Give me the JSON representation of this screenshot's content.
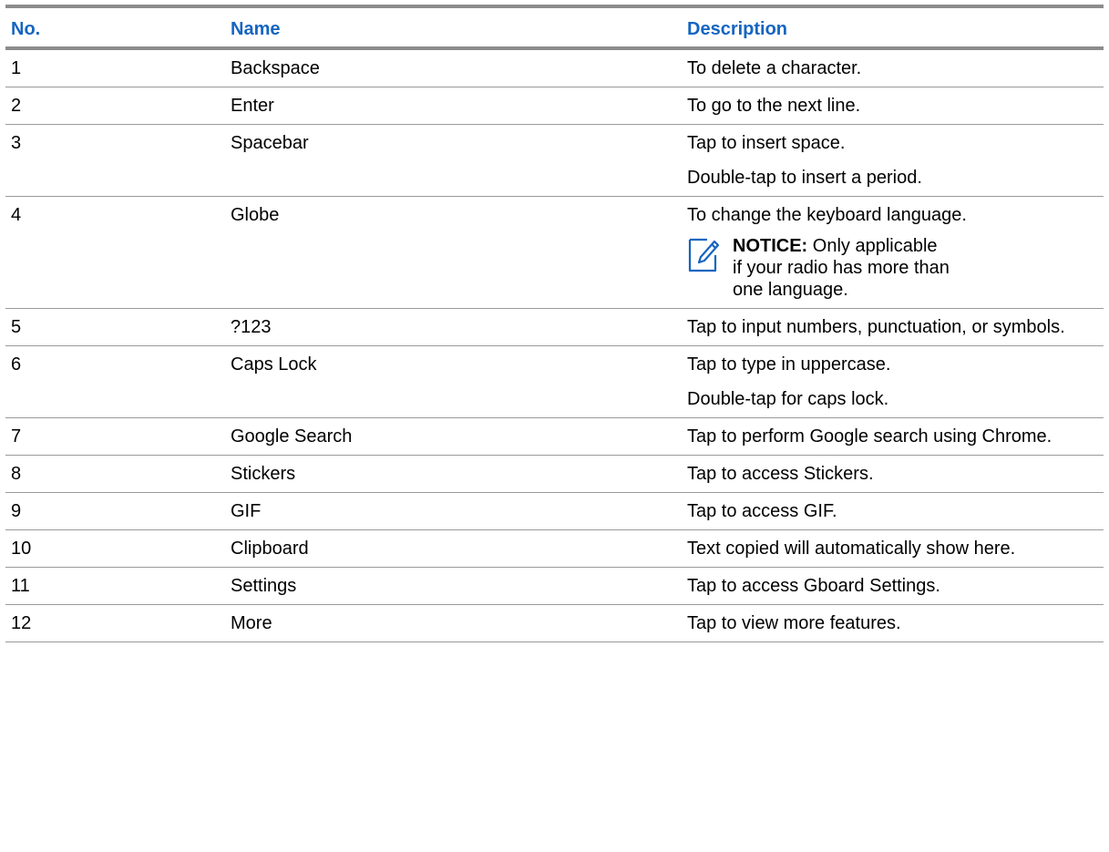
{
  "table": {
    "headers": {
      "no": "No.",
      "name": "Name",
      "description": "Description"
    },
    "rows": [
      {
        "no": "1",
        "name": "Backspace",
        "desc": [
          "To delete a character."
        ]
      },
      {
        "no": "2",
        "name": "Enter",
        "desc": [
          "To go to the next line."
        ]
      },
      {
        "no": "3",
        "name": "Spacebar",
        "desc": [
          "Tap to insert space.",
          "Double-tap to insert a period."
        ]
      },
      {
        "no": "4",
        "name": "Globe",
        "desc": [
          "To change the keyboard language."
        ],
        "notice": {
          "label": "NOTICE:",
          "text": "Only applicable if your radio has more than one language.",
          "icon": "notice-pencil-icon"
        }
      },
      {
        "no": "5",
        "name": "?123",
        "desc": [
          "Tap to input numbers, punctuation, or symbols."
        ]
      },
      {
        "no": "6",
        "name": "Caps Lock",
        "desc": [
          "Tap to type in uppercase.",
          "Double-tap for caps lock."
        ]
      },
      {
        "no": "7",
        "name": "Google Search",
        "desc": [
          "Tap to perform Google search using Chrome."
        ]
      },
      {
        "no": "8",
        "name": "Stickers",
        "desc": [
          "Tap to access Stickers."
        ]
      },
      {
        "no": "9",
        "name": "GIF",
        "desc": [
          "Tap to access GIF."
        ]
      },
      {
        "no": "10",
        "name": "Clipboard",
        "desc": [
          "Text copied will automatically show here."
        ]
      },
      {
        "no": "11",
        "name": "Settings",
        "desc": [
          "Tap to access Gboard Settings."
        ]
      },
      {
        "no": "12",
        "name": "More",
        "desc": [
          "Tap to view more features."
        ]
      }
    ]
  },
  "colors": {
    "header_text": "#1565c0",
    "header_rule": "#8c8c8c",
    "row_rule": "#9a9a9a",
    "icon_stroke": "#1565c0"
  }
}
